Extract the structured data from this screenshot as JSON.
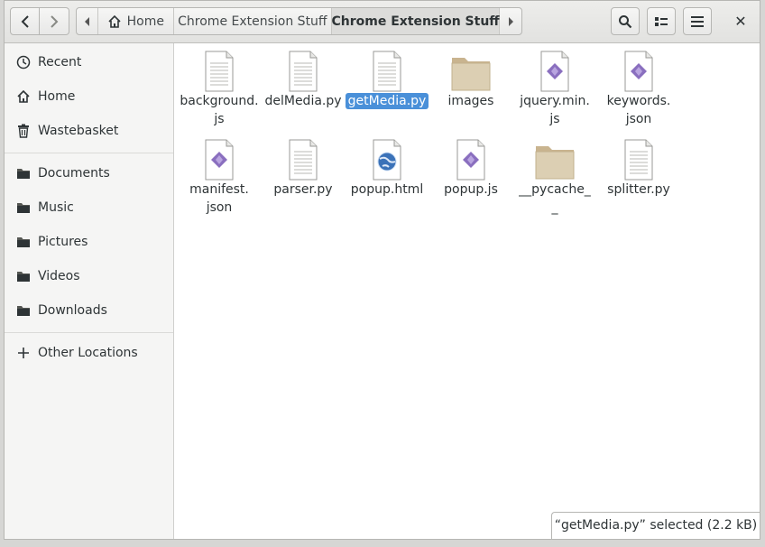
{
  "header": {
    "back_icon": "go-previous-icon",
    "forward_icon": "go-next-icon",
    "path": {
      "home_label": "Home",
      "crumb_label": "Chrome Extension Stuff",
      "current_label": "Chrome Extension Stuff"
    },
    "search_icon": "search-icon",
    "view_icon": "list-view-icon",
    "menu_icon": "hamburger-menu-icon",
    "close_glyph": "✕"
  },
  "sidebar": {
    "items": [
      {
        "label": "Recent",
        "icon": "clock-icon"
      },
      {
        "label": "Home",
        "icon": "home-icon"
      },
      {
        "label": "Wastebasket",
        "icon": "trash-icon"
      },
      {
        "label": "Documents",
        "icon": "folder-icon"
      },
      {
        "label": "Music",
        "icon": "folder-icon"
      },
      {
        "label": "Pictures",
        "icon": "folder-icon"
      },
      {
        "label": "Videos",
        "icon": "folder-icon"
      },
      {
        "label": "Downloads",
        "icon": "folder-icon"
      },
      {
        "label": "Other Locations",
        "icon": "plus-icon"
      }
    ]
  },
  "files": [
    {
      "name": "background.js",
      "line1": "background.",
      "line2": "js",
      "type": "text"
    },
    {
      "name": "delMedia.py",
      "line1": "delMedia.py",
      "line2": "",
      "type": "text"
    },
    {
      "name": "getMedia.py",
      "line1": "getMedia.py",
      "line2": "",
      "type": "text",
      "selected": true
    },
    {
      "name": "images",
      "line1": "images",
      "line2": "",
      "type": "folder"
    },
    {
      "name": "jquery.min.js",
      "line1": "jquery.min.",
      "line2": "js",
      "type": "script"
    },
    {
      "name": "keywords.json",
      "line1": "keywords.",
      "line2": "json",
      "type": "script"
    },
    {
      "name": "manifest.json",
      "line1": "manifest.",
      "line2": "json",
      "type": "script"
    },
    {
      "name": "parser.py",
      "line1": "parser.py",
      "line2": "",
      "type": "text"
    },
    {
      "name": "popup.html",
      "line1": "popup.html",
      "line2": "",
      "type": "html"
    },
    {
      "name": "popup.js",
      "line1": "popup.js",
      "line2": "",
      "type": "script"
    },
    {
      "name": "__pycache__",
      "line1": "__pycache_",
      "line2": "_",
      "type": "folder"
    },
    {
      "name": "splitter.py",
      "line1": "splitter.py",
      "line2": "",
      "type": "text"
    }
  ],
  "status": {
    "text": "“getMedia.py” selected  (2.2 kB)"
  },
  "colors": {
    "selection": "#4a90d9",
    "folder": "#d9c9a8",
    "script_icon": "#8a6fbf"
  }
}
